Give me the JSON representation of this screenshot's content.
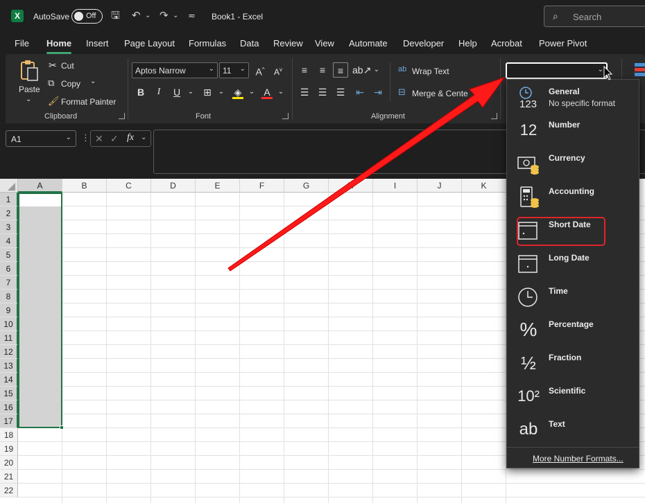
{
  "titlebar": {
    "autosave_label": "AutoSave",
    "autosave_state": "Off",
    "doc_title": "Book1  -  Excel",
    "search_placeholder": "Search"
  },
  "tabs": [
    {
      "label": "File"
    },
    {
      "label": "Home"
    },
    {
      "label": "Insert"
    },
    {
      "label": "Page Layout"
    },
    {
      "label": "Formulas"
    },
    {
      "label": "Data"
    },
    {
      "label": "Review"
    },
    {
      "label": "View"
    },
    {
      "label": "Automate"
    },
    {
      "label": "Developer"
    },
    {
      "label": "Help"
    },
    {
      "label": "Acrobat"
    },
    {
      "label": "Power Pivot"
    }
  ],
  "ribbon": {
    "paste": "Paste",
    "cut": "Cut",
    "copy": "Copy",
    "format_painter": "Format Painter",
    "clipboard_label": "Clipboard",
    "font_name": "Aptos Narrow",
    "font_size": "11",
    "font_label": "Font",
    "wrap_text": "Wrap Text",
    "merge_center": "Merge & Cente",
    "alignment_label": "Alignment",
    "number_format_value": "",
    "bold": "B",
    "italic": "I",
    "underline": "U"
  },
  "formula_bar": {
    "name_box": "A1",
    "fx": "fx",
    "formula": ""
  },
  "grid": {
    "columns": [
      "A",
      "B",
      "C",
      "D",
      "E",
      "F",
      "G",
      "H",
      "I",
      "J",
      "K"
    ],
    "rows": [
      "1",
      "2",
      "3",
      "4",
      "5",
      "6",
      "7",
      "8",
      "9",
      "10",
      "11",
      "12",
      "13",
      "14",
      "15",
      "16",
      "17",
      "18",
      "19",
      "20",
      "21",
      "22"
    ],
    "selected_column": "A",
    "selected_rows": "1-17"
  },
  "number_format_menu": {
    "items": [
      {
        "label": "General",
        "sub": "No specific format",
        "icon": "123"
      },
      {
        "label": "Number",
        "sub": "",
        "icon": "12"
      },
      {
        "label": "Currency",
        "sub": "",
        "icon": "currency-icon"
      },
      {
        "label": "Accounting",
        "sub": "",
        "icon": "accounting-icon"
      },
      {
        "label": "Short Date",
        "sub": "",
        "icon": "short-date-icon"
      },
      {
        "label": "Long Date",
        "sub": "",
        "icon": "long-date-icon"
      },
      {
        "label": "Time",
        "sub": "",
        "icon": "clock-icon"
      },
      {
        "label": "Percentage",
        "sub": "",
        "icon": "%"
      },
      {
        "label": "Fraction",
        "sub": "",
        "icon": "½"
      },
      {
        "label": "Scientific",
        "sub": "",
        "icon": "10²"
      },
      {
        "label": "Text",
        "sub": "",
        "icon": "ab"
      }
    ],
    "highlighted": "Short Date",
    "more": "More Number Formats..."
  },
  "colors": {
    "accent": "#217346",
    "highlight": "#e0242b",
    "arrow": "#ff1a1a"
  }
}
